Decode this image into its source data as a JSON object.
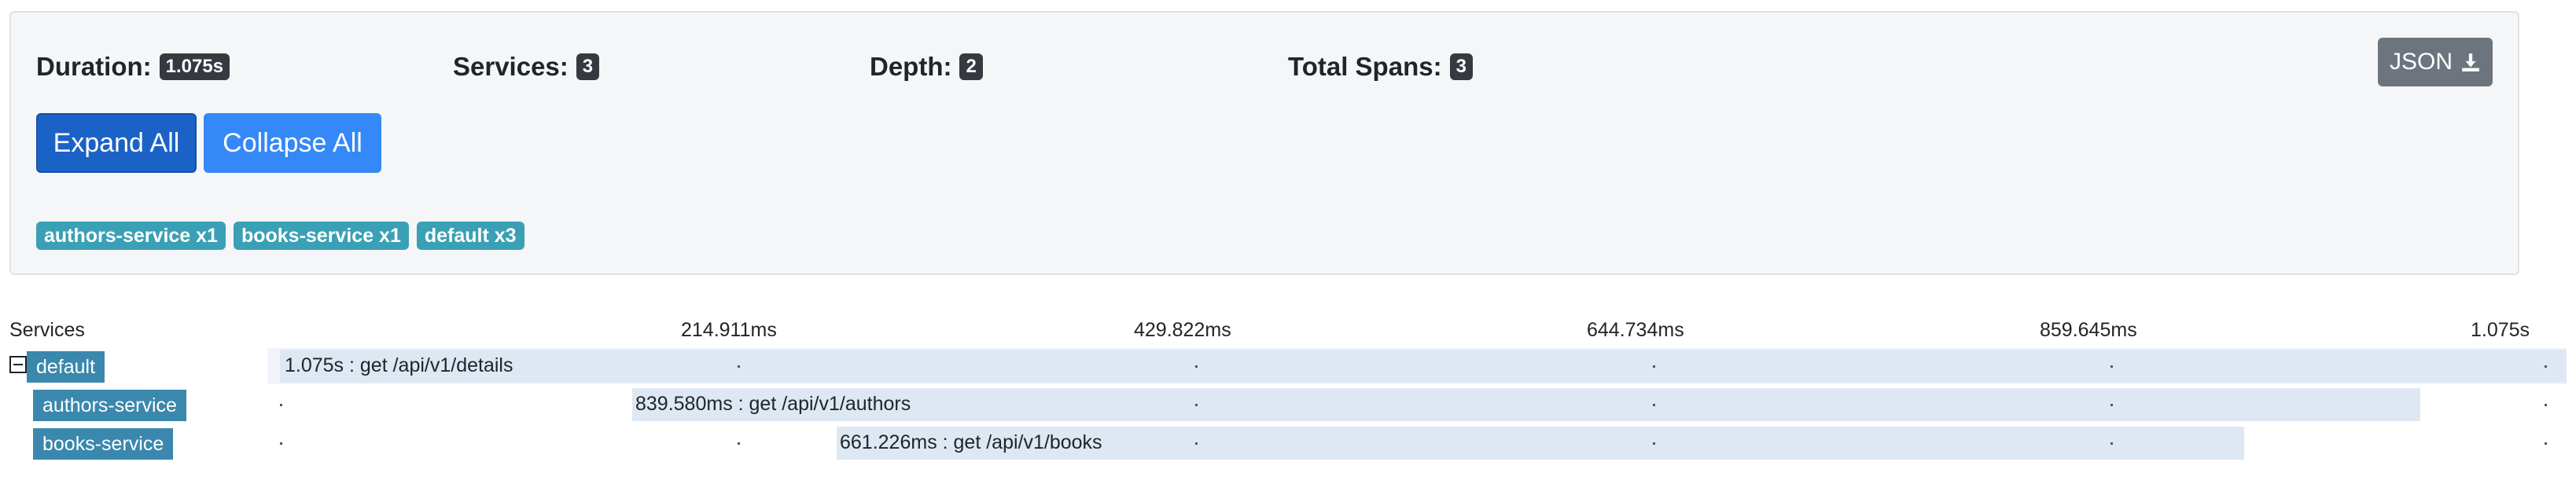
{
  "summary": {
    "duration": {
      "label": "Duration:",
      "value": "1.075s"
    },
    "services": {
      "label": "Services:",
      "value": "3"
    },
    "depth": {
      "label": "Depth:",
      "value": "2"
    },
    "total_spans": {
      "label": "Total Spans:",
      "value": "3"
    },
    "json_button": {
      "label": "JSON",
      "icon": "download-icon"
    }
  },
  "actions": {
    "expand_all": "Expand All",
    "collapse_all": "Collapse All"
  },
  "service_tags": [
    "authors-service x1",
    "books-service x1",
    "default x3"
  ],
  "timeline": {
    "services_header": "Services",
    "ticks": [
      "214.911ms",
      "429.822ms",
      "644.734ms",
      "859.645ms",
      "1.075s"
    ],
    "rows": [
      {
        "service": "default",
        "span_label": "1.075s : get /api/v1/details",
        "expanded": true
      },
      {
        "service": "authors-service",
        "span_label": "839.580ms : get /api/v1/authors"
      },
      {
        "service": "books-service",
        "span_label": "661.226ms : get /api/v1/books"
      }
    ]
  },
  "colors": {
    "badge": "#343a40",
    "expand_button": "#1b62c7",
    "collapse_button": "#3488f7",
    "json_button": "#6c757d",
    "service_tag": "#3aa0b5",
    "service_label": "#3a88ad",
    "span_bar": "#dde8f3"
  }
}
